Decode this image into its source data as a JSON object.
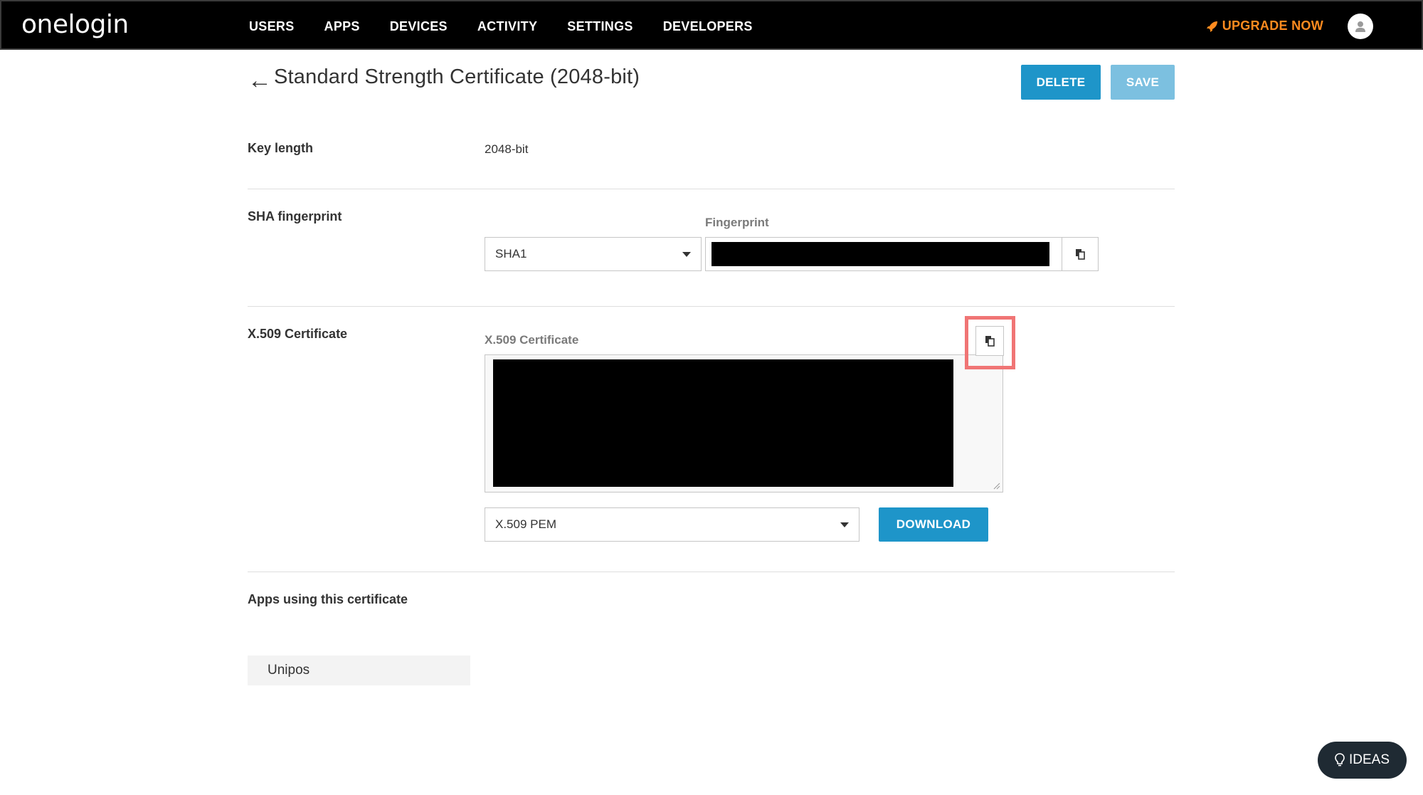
{
  "topbar": {
    "logo": "onelogin",
    "nav": [
      "USERS",
      "APPS",
      "DEVICES",
      "ACTIVITY",
      "SETTINGS",
      "DEVELOPERS"
    ],
    "upgrade_label": "UPGRADE NOW",
    "upgrade_color": "#ff8b1f"
  },
  "header": {
    "back_arrow": "←",
    "title": "Standard Strength Certificate (2048-bit)",
    "delete_label": "DELETE",
    "save_label": "SAVE"
  },
  "key_length": {
    "label": "Key length",
    "value": "2048-bit"
  },
  "sha": {
    "label": "SHA fingerprint",
    "algorithm_selected": "SHA1",
    "fingerprint_caption": "Fingerprint"
  },
  "x509": {
    "label": "X.509 Certificate",
    "caption": "X.509 Certificate",
    "format_selected": "X.509 PEM",
    "download_label": "DOWNLOAD"
  },
  "apps": {
    "label": "Apps using this certificate",
    "items": [
      "Unipos"
    ]
  },
  "ideas_label": "IDEAS",
  "colors": {
    "primary": "#1e95c9",
    "primary_disabled": "#7cc0e0",
    "highlight": "#f07575"
  }
}
